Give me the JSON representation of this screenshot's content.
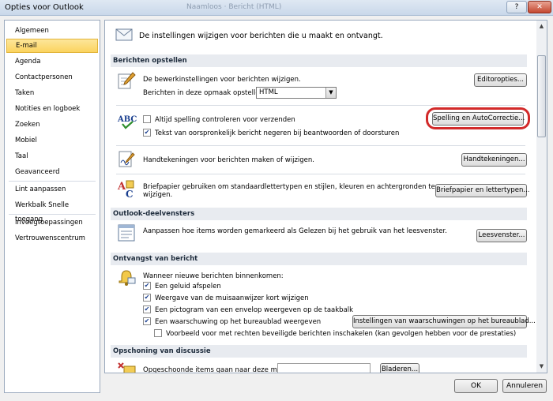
{
  "window": {
    "title": "Opties voor Outlook",
    "ghost_title": "Naamloos · Bericht (HTML)",
    "help_label": "?",
    "close_label": "✕"
  },
  "sidebar": {
    "items": [
      {
        "label": "Algemeen"
      },
      {
        "label": "E-mail",
        "selected": true
      },
      {
        "label": "Agenda"
      },
      {
        "label": "Contactpersonen"
      },
      {
        "label": "Taken"
      },
      {
        "label": "Notities en logboek"
      },
      {
        "label": "Zoeken"
      },
      {
        "label": "Mobiel"
      },
      {
        "label": "Taal"
      },
      {
        "label": "Geavanceerd"
      },
      {
        "label": "Lint aanpassen"
      },
      {
        "label": "Werkbalk Snelle toegang"
      },
      {
        "label": "Invoegtoepassingen"
      },
      {
        "label": "Vertrouwenscentrum"
      }
    ]
  },
  "main": {
    "intro": "De instellingen wijzigen voor berichten die u maakt en ontvangt.",
    "compose": {
      "header": "Berichten opstellen",
      "edit_text": "De bewerkinstellingen voor berichten wijzigen.",
      "editor_button": "Editoropties...",
      "format_label": "Berichten in deze opmaak opstellen",
      "format_value": "HTML",
      "spell_always": "Altijd spelling controleren voor verzenden",
      "spell_ignore": "Tekst van oorspronkelijk bericht negeren bij beantwoorden of doorsturen",
      "spell_button": "Spelling en AutoCorrectie...",
      "signatures_text": "Handtekeningen voor berichten maken of wijzigen.",
      "signatures_button": "Handtekeningen...",
      "stationery_text_1": "Briefpapier gebruiken om standaardlettertypen en stijlen, kleuren en achtergronden te",
      "stationery_text_2": "wijzigen.",
      "stationery_button": "Briefpapier en lettertypen..."
    },
    "reading_pane": {
      "header": "Outlook-deelvensters",
      "text": "Aanpassen hoe items worden gemarkeerd als Gelezen bij het gebruik van het leesvenster.",
      "button": "Leesvenster..."
    },
    "arrival": {
      "header": "Ontvangst van bericht",
      "intro": "Wanneer nieuwe berichten binnenkomen:",
      "options": [
        "Een geluid afspelen",
        "Weergave van de muisaanwijzer kort wijzigen",
        "Een pictogram van een envelop weergeven op de taakbalk",
        "Een waarschuwing op het bureaublad weergeven"
      ],
      "preview_rights": "Voorbeeld voor met rechten beveiligde berichten inschakelen (kan gevolgen hebben voor de prestaties)",
      "alert_settings_button": "Instellingen van waarschuwingen op het bureaublad..."
    },
    "cleanup": {
      "header": "Opschoning van discussie",
      "text": "Opgeschoonde items gaan naar deze map:",
      "folder_value": "",
      "browse_button": "Bladeren..."
    }
  },
  "footer": {
    "ok": "OK",
    "cancel": "Annuleren"
  },
  "colors": {
    "selection": "#fbd35f",
    "highlight_ring": "#d22a2a",
    "section_header_bg": "#e8ebf0"
  }
}
